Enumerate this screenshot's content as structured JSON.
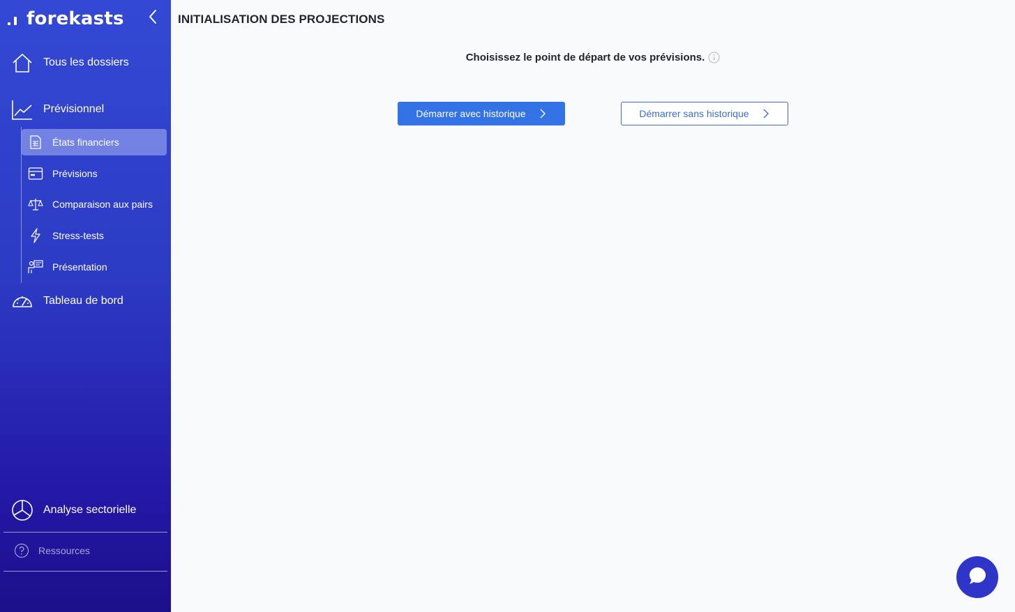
{
  "brand": {
    "name": "forekasts"
  },
  "sidebar": {
    "home": {
      "label": "Tous les dossiers",
      "icon": "home-icon"
    },
    "forecast": {
      "label": "Prévisionnel",
      "icon": "trend-chart-icon"
    },
    "sub_items": [
      {
        "label": "États financiers",
        "icon": "document-list-icon",
        "active": true
      },
      {
        "label": "Prévisions",
        "icon": "credit-card-icon",
        "active": false
      },
      {
        "label": "Comparaison aux pairs",
        "icon": "balance-scale-icon",
        "active": false
      },
      {
        "label": "Stress-tests",
        "icon": "lightning-icon",
        "active": false
      },
      {
        "label": "Présentation",
        "icon": "presenter-icon",
        "active": false
      }
    ],
    "dashboard": {
      "label": "Tableau de bord",
      "icon": "speedometer-icon"
    },
    "sector": {
      "label": "Analyse sectorielle",
      "icon": "pie-chart-icon"
    },
    "resources": {
      "label": "Ressources",
      "icon": "question-circle-icon"
    }
  },
  "main": {
    "title": "INITIALISATION DES PROJECTIONS",
    "question": "Choisissez le point de départ de vos prévisions.",
    "buttons": {
      "with_history": "Démarrer avec historique",
      "without_history": "Démarrer sans historique"
    }
  },
  "colors": {
    "sidebar_top": "#3349d4",
    "sidebar_bottom": "#1c0f8a",
    "primary": "#3373e6",
    "chat": "#2f35c9"
  }
}
